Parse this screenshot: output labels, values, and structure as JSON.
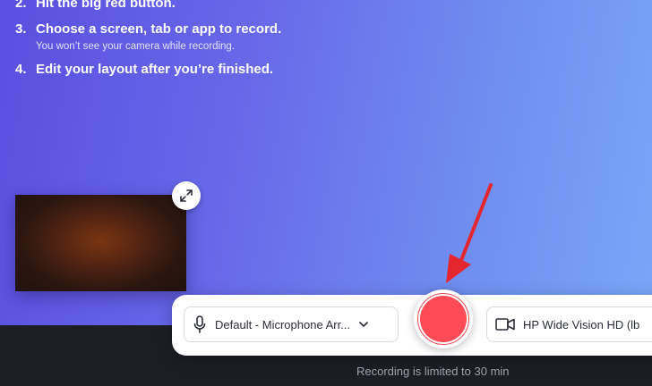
{
  "instructions": {
    "steps": [
      {
        "num": "2.",
        "text": "Hit the big red button."
      },
      {
        "num": "3.",
        "text": "Choose a screen, tab or app to record.",
        "note": "You won’t see your camera while recording."
      },
      {
        "num": "4.",
        "text": "Edit your layout after you’re finished."
      }
    ]
  },
  "controls": {
    "microphone": {
      "selected": "Default - Microphone Arr..."
    },
    "camera": {
      "selected": "HP Wide Vision HD (lb"
    },
    "record_note": "Recording is limited to 30 min"
  },
  "icons": {
    "expand": "expand-icon",
    "microphone": "microphone-icon",
    "dropdown": "chevron-down-icon",
    "camera": "video-camera-icon",
    "annotation": "red-arrow-annotation"
  },
  "colors": {
    "record": "#ff4b55",
    "arrow": "#e5262e",
    "gradient_start": "#5a4fe0",
    "gradient_end": "#7aa6f6"
  }
}
